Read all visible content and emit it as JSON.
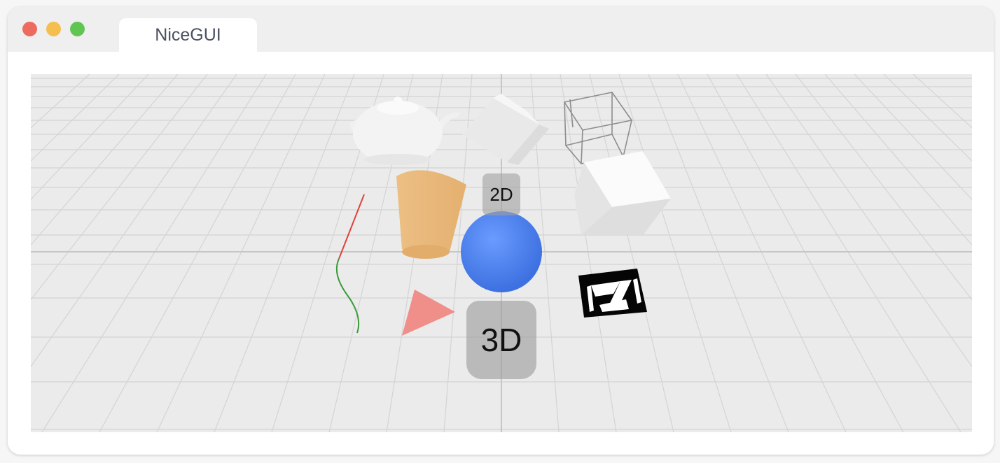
{
  "window": {
    "tab_title": "NiceGUI",
    "traffic_lights": {
      "close_color": "#ec6a5e",
      "minimize_color": "#f4bf4f",
      "zoom_color": "#61c554"
    }
  },
  "scene": {
    "background_color": "#ebebeb",
    "labels": {
      "text_2d": "2D",
      "text_3d": "3D"
    },
    "objects": [
      {
        "name": "teapot",
        "color": "#f2f2f2"
      },
      {
        "name": "cube",
        "color": "#e8e8e8"
      },
      {
        "name": "wireframe-box",
        "color": "#8a8a8a"
      },
      {
        "name": "white-box",
        "color": "#f5f5f5"
      },
      {
        "name": "cylinder",
        "color": "#eab97a"
      },
      {
        "name": "sphere",
        "color": "#4f84f0"
      },
      {
        "name": "curve",
        "color": "#3a9b3a"
      },
      {
        "name": "triangle",
        "color": "#f08a86"
      },
      {
        "name": "zauberzeug-logo",
        "color": "#000000"
      }
    ]
  }
}
